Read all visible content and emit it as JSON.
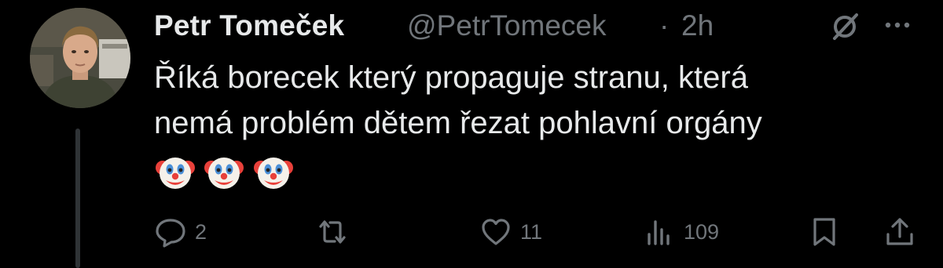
{
  "tweet": {
    "author_name": "Petr Tomeček",
    "handle": "@PetrTomecek",
    "separator": "·",
    "time": "2h",
    "text_lines": [
      "Říká borecek který propaguje stranu, která",
      "nemá problém dětem řezat pohlavní orgány"
    ],
    "emojis": [
      "clown-face",
      "clown-face",
      "clown-face"
    ]
  },
  "actions": {
    "replies": "2",
    "retweets": "",
    "likes": "11",
    "views": "109"
  },
  "icons": {
    "header": [
      "grok-icon",
      "more-options-icon"
    ],
    "actions": [
      "reply-icon",
      "retweet-icon",
      "like-icon",
      "views-icon",
      "bookmark-icon",
      "share-icon"
    ]
  },
  "colors": {
    "background": "#000000",
    "primary_text": "#e7e9ea",
    "secondary_text": "#71767b",
    "thread_line": "#2f3336"
  }
}
